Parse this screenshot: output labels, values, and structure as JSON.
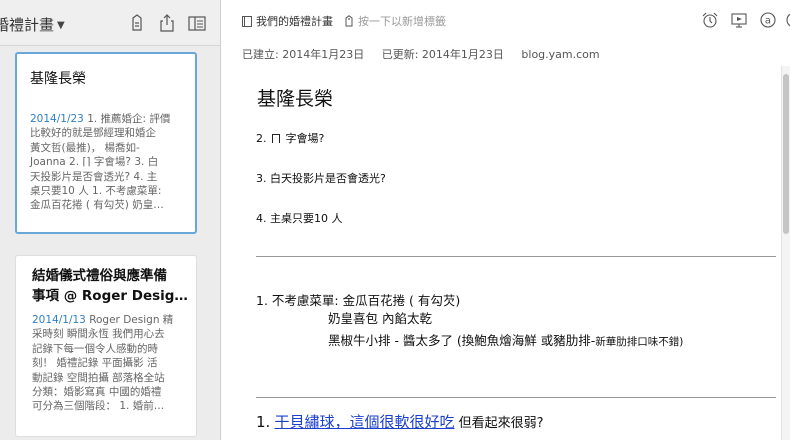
{
  "notebook_selector": {
    "label": "婚禮計畫"
  },
  "list_icons": [
    "remove-note-icon",
    "share-icon",
    "layout-icon"
  ],
  "notes": [
    {
      "title": "基隆長榮",
      "date": "2014/1/23",
      "snippet_lines": [
        "1. 推薦婚企: 評價",
        "比較好的就是鄧經理和婚企",
        "黃文哲(最推)， 楊喬如-",
        "Joanna 2. ⌈⌉ 字會場? 3. 白",
        "天投影片是否會透光? 4. 主",
        "桌只要10 人 1. 不考慮菜單:",
        "金瓜百花捲 ( 有勾芡) 奶皇…"
      ]
    },
    {
      "title_lines": [
        "結婚儀式禮俗與應準備",
        "事項 @ Roger Desig…"
      ],
      "date": "2014/1/13",
      "snippet_lines": [
        "Roger Design 精",
        "采時刻 瞬間永恆 我們用心去",
        "記錄下每一個令人感動的時",
        "刻！ 婚禮記錄 平面攝影 活",
        "動記錄 空間拍攝 部落格全站",
        "分類：婚影寫真 中國的婚禮",
        "可分為三個階段： 1. 婚前…"
      ]
    }
  ],
  "editor": {
    "notebook_link": "我們的婚禮計畫",
    "tag_placeholder": "按一下以新增標籤",
    "created": "已建立: 2014年1月23日",
    "updated": "已更新: 2014年1月23日",
    "source": "blog.yam.com",
    "toolbar_icons": [
      "reminder-icon",
      "present-icon",
      "info-icon",
      "more-icon"
    ]
  },
  "note_body": {
    "title": "基隆長榮",
    "q2_pre": "2.",
    "q2_post": "字會場?",
    "q3": "3. 白天投影片是否會透光?",
    "q4": "4. 主桌只要10 人",
    "menu_line": "1. 不考慮菜單: 金瓜百花捲 ( 有勾芡)",
    "menu_item_2": "奶皇喜包 內餡太乾",
    "menu_item_3_main": "黑椒牛小排 - 醬太多了 (換鮑魚燴海鮮 或豬肋排-",
    "menu_item_3_note": "新華肋排口味不錯)",
    "bottom_num": "1.",
    "bottom_link": "干貝繡球，這個很軟很好吃",
    "bottom_rest": "但看起來很弱?"
  }
}
